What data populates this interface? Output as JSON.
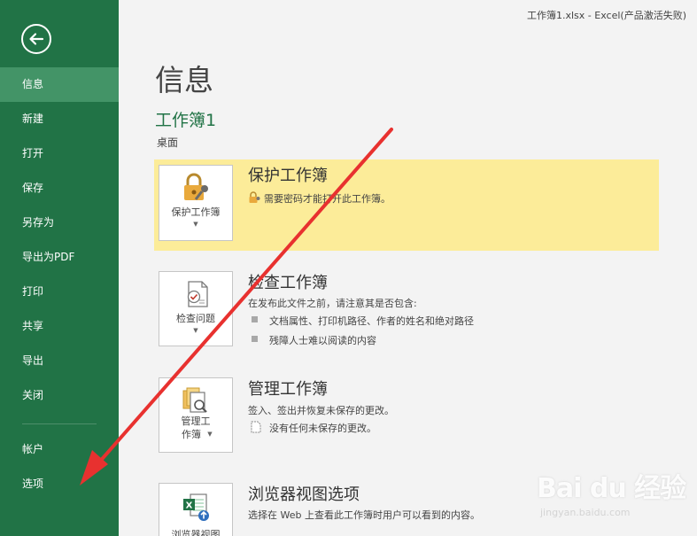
{
  "window": {
    "title": "工作簿1.xlsx - Excel(产品激活失败)"
  },
  "sidebar": {
    "items": [
      {
        "label": "信息",
        "active": true
      },
      {
        "label": "新建"
      },
      {
        "label": "打开"
      },
      {
        "label": "保存"
      },
      {
        "label": "另存为"
      },
      {
        "label": "导出为PDF"
      },
      {
        "label": "打印"
      },
      {
        "label": "共享"
      },
      {
        "label": "导出"
      },
      {
        "label": "关闭"
      }
    ],
    "bottom_items": [
      {
        "label": "帐户"
      },
      {
        "label": "选项"
      }
    ]
  },
  "main": {
    "page_title": "信息",
    "doc_name": "工作簿1",
    "doc_path": "桌面",
    "sections": [
      {
        "tile_label": "保护工作簿",
        "heading": "保护工作簿",
        "lines": [
          "需要密码才能打开此工作簿。"
        ]
      },
      {
        "tile_label": "检查问题",
        "heading": "检查工作簿",
        "lines": [
          "在发布此文件之前，请注意其是否包含:",
          "文档属性、打印机路径、作者的姓名和绝对路径",
          "残障人士难以阅读的内容"
        ]
      },
      {
        "tile_label_1": "管理工",
        "tile_label_2": "作簿",
        "heading": "管理工作簿",
        "lines": [
          "签入、签出并恢复未保存的更改。",
          "没有任何未保存的更改。"
        ]
      },
      {
        "tile_label": "浏览器视图",
        "heading": "浏览器视图选项",
        "lines": [
          "选择在 Web 上查看此工作簿时用户可以看到的内容。"
        ]
      }
    ]
  },
  "watermark": {
    "text": "Bai du 经验",
    "sub": "jingyan.baidu.com"
  },
  "colors": {
    "sidebar": "#217346",
    "sidebar_active": "#439467",
    "highlight": "#fcec99",
    "annotation_arrow": "#e8312f"
  }
}
